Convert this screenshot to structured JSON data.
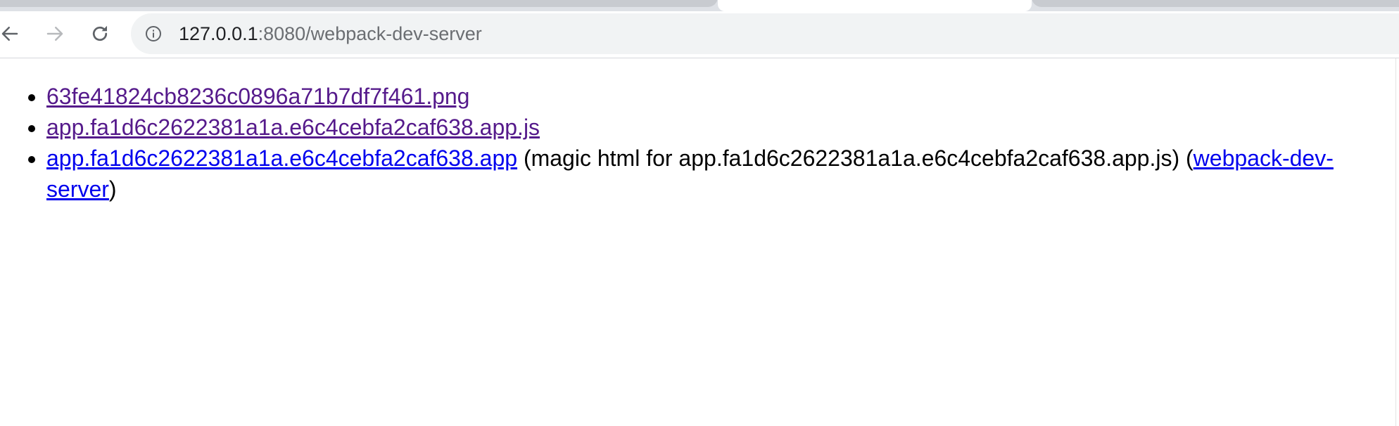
{
  "browser": {
    "url_host": "127.0.0.1",
    "url_rest": ":8080/webpack-dev-server",
    "icons": {
      "back": "arrow-left-icon",
      "forward": "arrow-right-icon",
      "reload": "reload-icon",
      "site_info": "info-icon"
    }
  },
  "listing": {
    "items": [
      {
        "link": "63fe41824cb8236c0896a71b7df7f461.png"
      },
      {
        "link": "app.fa1d6c2622381a1a.e6c4cebfa2caf638.app.js"
      },
      {
        "link": "app.fa1d6c2622381a1a.e6c4cebfa2caf638.app",
        "note": " (magic html for app.fa1d6c2622381a1a.e6c4cebfa2caf638.app.js) (",
        "extra_link": "webpack-dev-server",
        "close": ")"
      }
    ]
  },
  "colors": {
    "visited_link": "#551a8b",
    "unvisited_link": "#0000ee",
    "omnibox_bg": "#f1f3f4"
  }
}
